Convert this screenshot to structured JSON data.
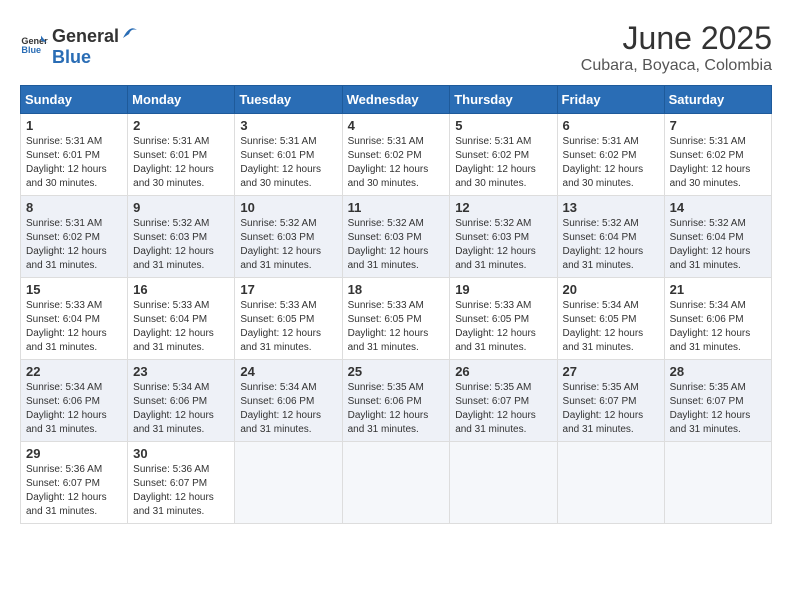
{
  "header": {
    "logo_general": "General",
    "logo_blue": "Blue",
    "title": "June 2025",
    "subtitle": "Cubara, Boyaca, Colombia"
  },
  "calendar": {
    "days_of_week": [
      "Sunday",
      "Monday",
      "Tuesday",
      "Wednesday",
      "Thursday",
      "Friday",
      "Saturday"
    ],
    "weeks": [
      [
        {
          "day": "1",
          "sunrise": "5:31 AM",
          "sunset": "6:01 PM",
          "daylight": "12 hours and 30 minutes."
        },
        {
          "day": "2",
          "sunrise": "5:31 AM",
          "sunset": "6:01 PM",
          "daylight": "12 hours and 30 minutes."
        },
        {
          "day": "3",
          "sunrise": "5:31 AM",
          "sunset": "6:01 PM",
          "daylight": "12 hours and 30 minutes."
        },
        {
          "day": "4",
          "sunrise": "5:31 AM",
          "sunset": "6:02 PM",
          "daylight": "12 hours and 30 minutes."
        },
        {
          "day": "5",
          "sunrise": "5:31 AM",
          "sunset": "6:02 PM",
          "daylight": "12 hours and 30 minutes."
        },
        {
          "day": "6",
          "sunrise": "5:31 AM",
          "sunset": "6:02 PM",
          "daylight": "12 hours and 30 minutes."
        },
        {
          "day": "7",
          "sunrise": "5:31 AM",
          "sunset": "6:02 PM",
          "daylight": "12 hours and 30 minutes."
        }
      ],
      [
        {
          "day": "8",
          "sunrise": "5:31 AM",
          "sunset": "6:02 PM",
          "daylight": "12 hours and 31 minutes."
        },
        {
          "day": "9",
          "sunrise": "5:32 AM",
          "sunset": "6:03 PM",
          "daylight": "12 hours and 31 minutes."
        },
        {
          "day": "10",
          "sunrise": "5:32 AM",
          "sunset": "6:03 PM",
          "daylight": "12 hours and 31 minutes."
        },
        {
          "day": "11",
          "sunrise": "5:32 AM",
          "sunset": "6:03 PM",
          "daylight": "12 hours and 31 minutes."
        },
        {
          "day": "12",
          "sunrise": "5:32 AM",
          "sunset": "6:03 PM",
          "daylight": "12 hours and 31 minutes."
        },
        {
          "day": "13",
          "sunrise": "5:32 AM",
          "sunset": "6:04 PM",
          "daylight": "12 hours and 31 minutes."
        },
        {
          "day": "14",
          "sunrise": "5:32 AM",
          "sunset": "6:04 PM",
          "daylight": "12 hours and 31 minutes."
        }
      ],
      [
        {
          "day": "15",
          "sunrise": "5:33 AM",
          "sunset": "6:04 PM",
          "daylight": "12 hours and 31 minutes."
        },
        {
          "day": "16",
          "sunrise": "5:33 AM",
          "sunset": "6:04 PM",
          "daylight": "12 hours and 31 minutes."
        },
        {
          "day": "17",
          "sunrise": "5:33 AM",
          "sunset": "6:05 PM",
          "daylight": "12 hours and 31 minutes."
        },
        {
          "day": "18",
          "sunrise": "5:33 AM",
          "sunset": "6:05 PM",
          "daylight": "12 hours and 31 minutes."
        },
        {
          "day": "19",
          "sunrise": "5:33 AM",
          "sunset": "6:05 PM",
          "daylight": "12 hours and 31 minutes."
        },
        {
          "day": "20",
          "sunrise": "5:34 AM",
          "sunset": "6:05 PM",
          "daylight": "12 hours and 31 minutes."
        },
        {
          "day": "21",
          "sunrise": "5:34 AM",
          "sunset": "6:06 PM",
          "daylight": "12 hours and 31 minutes."
        }
      ],
      [
        {
          "day": "22",
          "sunrise": "5:34 AM",
          "sunset": "6:06 PM",
          "daylight": "12 hours and 31 minutes."
        },
        {
          "day": "23",
          "sunrise": "5:34 AM",
          "sunset": "6:06 PM",
          "daylight": "12 hours and 31 minutes."
        },
        {
          "day": "24",
          "sunrise": "5:34 AM",
          "sunset": "6:06 PM",
          "daylight": "12 hours and 31 minutes."
        },
        {
          "day": "25",
          "sunrise": "5:35 AM",
          "sunset": "6:06 PM",
          "daylight": "12 hours and 31 minutes."
        },
        {
          "day": "26",
          "sunrise": "5:35 AM",
          "sunset": "6:07 PM",
          "daylight": "12 hours and 31 minutes."
        },
        {
          "day": "27",
          "sunrise": "5:35 AM",
          "sunset": "6:07 PM",
          "daylight": "12 hours and 31 minutes."
        },
        {
          "day": "28",
          "sunrise": "5:35 AM",
          "sunset": "6:07 PM",
          "daylight": "12 hours and 31 minutes."
        }
      ],
      [
        {
          "day": "29",
          "sunrise": "5:36 AM",
          "sunset": "6:07 PM",
          "daylight": "12 hours and 31 minutes."
        },
        {
          "day": "30",
          "sunrise": "5:36 AM",
          "sunset": "6:07 PM",
          "daylight": "12 hours and 31 minutes."
        },
        null,
        null,
        null,
        null,
        null
      ]
    ]
  }
}
